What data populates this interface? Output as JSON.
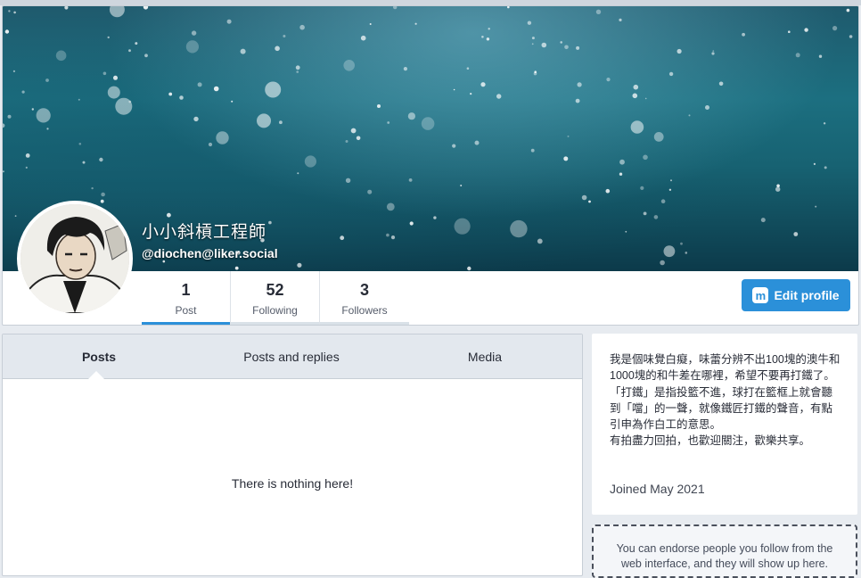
{
  "profile": {
    "display_name": "小小斜槓工程師",
    "account": "@diochen@liker.social",
    "edit_label": "Edit profile",
    "counters": [
      {
        "value": "1",
        "label": "Post"
      },
      {
        "value": "52",
        "label": "Following"
      },
      {
        "value": "3",
        "label": "Followers"
      }
    ]
  },
  "timeline": {
    "tabs": [
      "Posts",
      "Posts and replies",
      "Media"
    ],
    "active_tab": "Posts",
    "empty_message": "There is nothing here!"
  },
  "bio": {
    "paragraphs": [
      "我是個味覺白癡，味蕾分辨不出100塊的澳牛和1000塊的和牛差在哪裡，希望不要再打鐵了。",
      "「打鐵」是指投籃不進，球打在籃框上就會聽到「噹」的一聲，就像鐵匠打鐵的聲音，有點引申為作白工的意思。",
      "有拍盡力回拍，也歡迎關注，歡樂共享。"
    ],
    "joined": "Joined May 2021"
  },
  "endorse_text": "You can endorse people you follow from the web interface, and they will show up here.",
  "colors": {
    "accent": "#2b90d9",
    "tab_bg": "#e3e8ee",
    "page_bg": "#e7ebf0"
  },
  "icons": {
    "edit": "mastodon-logo-icon"
  }
}
